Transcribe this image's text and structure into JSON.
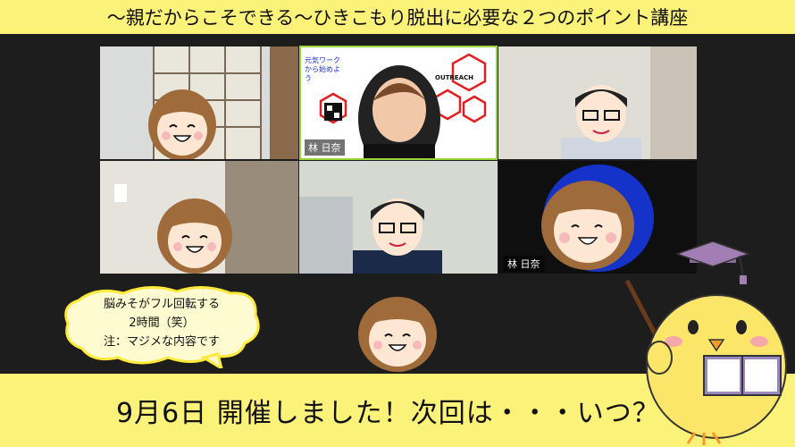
{
  "banner": {
    "title": "～親だからこそできる～ひきこもり脱出に必要な２つのポイント講座"
  },
  "tiles": {
    "host_name": "林 日奈",
    "bottom_partial_name": "林 日奈",
    "sign_text_left": "元気ワークから始めよう",
    "sign_text_right": "OUTREACH"
  },
  "bubble": {
    "line1": "脳みそがフル回転する",
    "line2": "2時間（笑）",
    "line3": "注：マジメな内容です"
  },
  "footer": {
    "announcement": "9月6日 開催しました！次回は・・・いつ？"
  },
  "colors": {
    "banner_bg": "#fbf27a",
    "zoom_bg": "#1d1d1d",
    "active_speaker_border": "#9ad33a",
    "chick": "#fbe66a"
  }
}
